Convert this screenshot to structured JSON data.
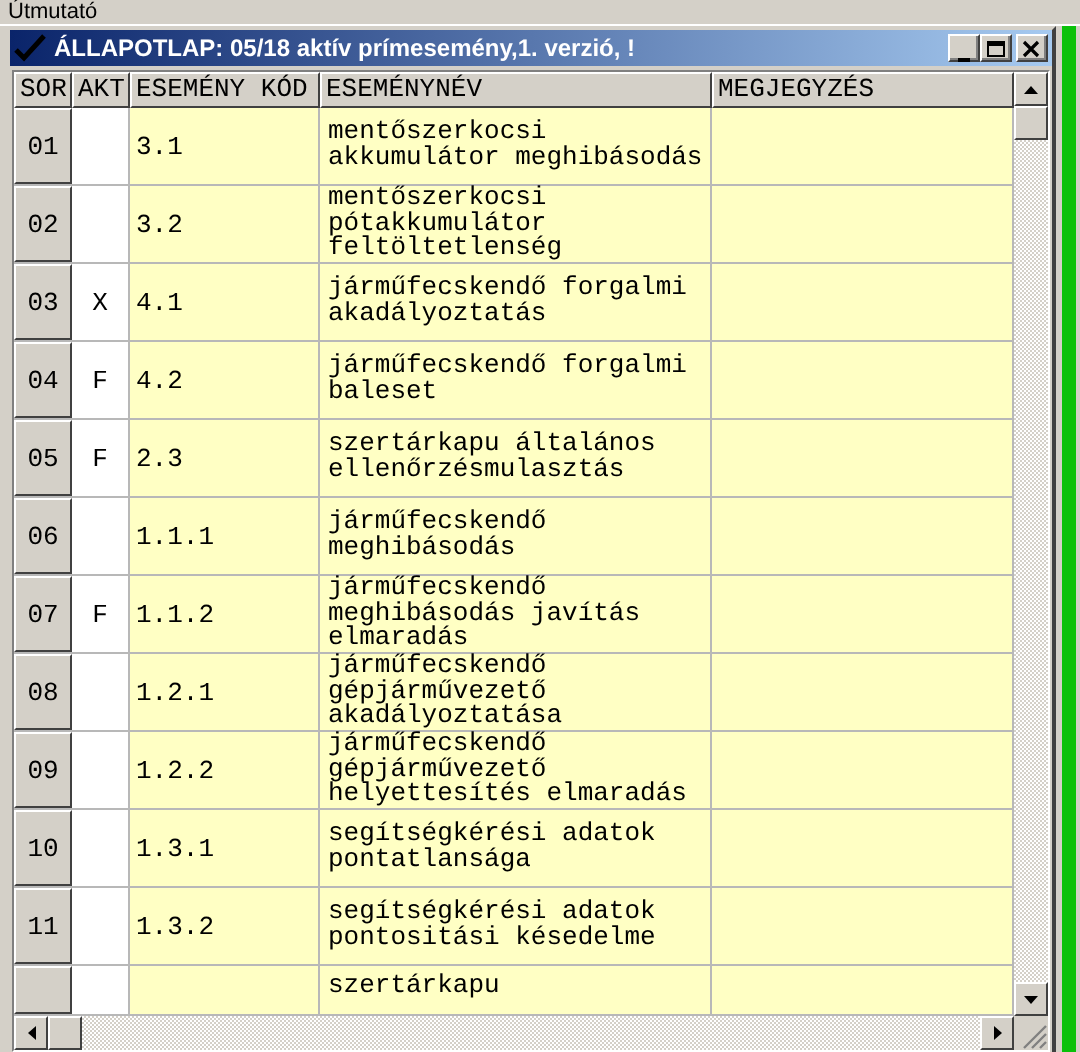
{
  "menu_bar": {
    "items": [
      "Útmutató"
    ]
  },
  "window": {
    "title": "ÁLLAPOTLAP: 05/18 aktív prímesemény,1. verzió, !"
  },
  "table": {
    "columns": [
      "SOR",
      "AKT",
      "ESEMÉNY KÓD",
      "ESEMÉNYNÉV",
      "MEGJEGYZÉS"
    ],
    "rows": [
      {
        "sor": "01",
        "kod": "3.1",
        "nev": "mentőszerkocsi akkumulátor meghibásodás"
      },
      {
        "sor": "02",
        "kod": "3.2",
        "nev": "mentőszerkocsi pótakkumulátor feltöltetlenség"
      },
      {
        "sor": "03",
        "akt": "X",
        "kod": "4.1",
        "nev": "járműfecskendő forgalmi akadályoztatás"
      },
      {
        "sor": "04",
        "akt": "F",
        "kod": "4.2",
        "nev": "járműfecskendő forgalmi baleset"
      },
      {
        "sor": "05",
        "akt": "F",
        "kod": "2.3",
        "nev": "szertárkapu általános ellenőrzésmulasztás"
      },
      {
        "sor": "06",
        "kod": "1.1.1",
        "nev": "járműfecskendő meghibásodás"
      },
      {
        "sor": "07",
        "akt": "F",
        "kod": "1.1.2",
        "nev": "járműfecskendő meghibásodás javítás elmaradás"
      },
      {
        "sor": "08",
        "kod": "1.2.1",
        "nev": "járműfecskendő gépjárművezető akadályoztatása"
      },
      {
        "sor": "09",
        "kod": "1.2.2",
        "nev": "járműfecskendő gépjárművezető helyettesítés elmaradás"
      },
      {
        "sor": "10",
        "kod": "1.3.1",
        "nev": "segítségkérési adatok pontatlansága"
      },
      {
        "sor": "11",
        "kod": "1.3.2",
        "nev": "segítségkérési adatok pontositási késedelme"
      },
      {
        "nev": "szertárkapu"
      }
    ]
  }
}
